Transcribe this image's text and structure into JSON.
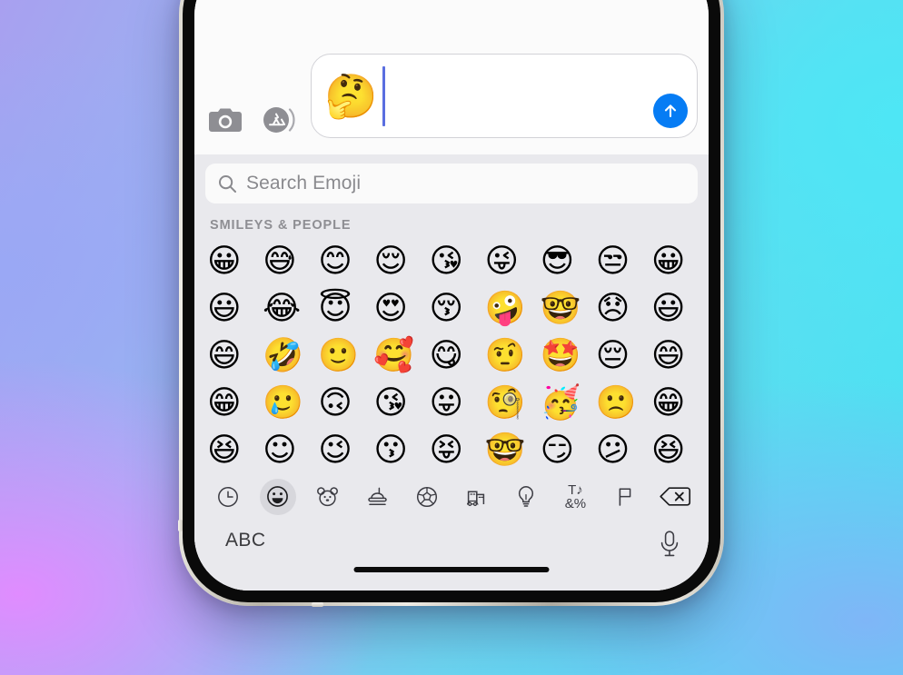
{
  "background": {
    "gradient_colors": [
      "#e08cff",
      "#9aa8f5",
      "#4ee6f5",
      "#7fb6f7"
    ]
  },
  "device": {
    "name": "iphone",
    "frame_color": "#c9c5ba",
    "bezel_color": "#0a0a0a"
  },
  "compose": {
    "camera_icon": "camera-icon",
    "appstore_icon": "app-store-icon",
    "typed_text": "🤔",
    "caret_color": "#5a6ee0",
    "send_icon": "arrow-up-icon",
    "send_color": "#067cf4"
  },
  "search": {
    "icon": "search-icon",
    "placeholder": "Search Emoji"
  },
  "keyboard": {
    "background": "#e9e9ed",
    "section_title": "SMILEYS & PEOPLE",
    "rows": [
      [
        "😀",
        "😅",
        "😊",
        "😌",
        "😘",
        "😜",
        "😎",
        "😒",
        "😀"
      ],
      [
        "😃",
        "😂",
        "😇",
        "😍",
        "😚",
        "🤪",
        "🤓",
        "😞",
        "😃"
      ],
      [
        "😄",
        "🤣",
        "🙂",
        "🥰",
        "😋",
        "🤨",
        "🤩",
        "😔",
        "😄"
      ],
      [
        "😁",
        "🥲",
        "🙃",
        "😘",
        "😛",
        "🧐",
        "🥳",
        "🙁",
        "😁"
      ],
      [
        "😆",
        "☺",
        "😉",
        "😗",
        "😝",
        "🤓",
        "😏",
        "😕",
        "😆"
      ]
    ]
  },
  "categories": [
    {
      "name": "recents",
      "icon": "clock-icon",
      "active": false
    },
    {
      "name": "smileys",
      "icon": "smiley-icon",
      "active": true
    },
    {
      "name": "animals",
      "icon": "bear-icon",
      "active": false
    },
    {
      "name": "food",
      "icon": "food-icon",
      "active": false
    },
    {
      "name": "activity",
      "icon": "soccer-ball-icon",
      "active": false
    },
    {
      "name": "travel",
      "icon": "car-building-icon",
      "active": false
    },
    {
      "name": "objects",
      "icon": "lightbulb-icon",
      "active": false
    },
    {
      "name": "symbols",
      "icon": "symbols-icon",
      "label_top": "T♪",
      "label_bottom": "&%",
      "active": false
    },
    {
      "name": "flags",
      "icon": "flag-icon",
      "active": false
    },
    {
      "name": "delete",
      "icon": "backspace-icon",
      "active": false
    }
  ],
  "bottom": {
    "abc_label": "ABC",
    "mic_icon": "microphone-icon"
  }
}
